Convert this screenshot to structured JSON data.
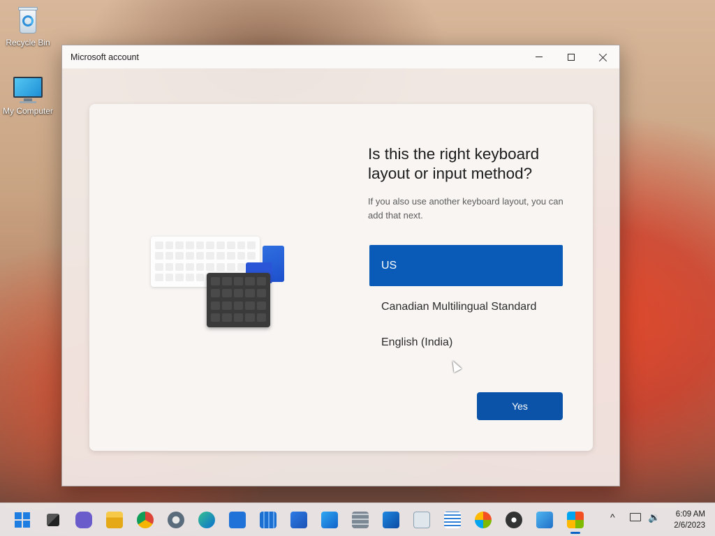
{
  "desktop": {
    "icons": [
      {
        "label": "Recycle Bin",
        "icon": "recycle-bin-icon"
      },
      {
        "label": "My Computer",
        "icon": "monitor-icon"
      }
    ]
  },
  "window": {
    "title": "Microsoft account",
    "controls": [
      "minimize",
      "maximize",
      "close"
    ]
  },
  "oobe": {
    "heading": "Is this the right keyboard layout or input method?",
    "description": "If you also use another keyboard layout, you can add that next.",
    "options": [
      {
        "label": "US",
        "selected": true
      },
      {
        "label": "Canadian Multilingual Standard",
        "selected": false
      },
      {
        "label": "English (India)",
        "selected": false
      }
    ],
    "primary_button": "Yes"
  },
  "taskbar": {
    "apps": [
      "start-icon",
      "task-view-icon",
      "chat-icon",
      "file-explorer-icon",
      "chrome-icon",
      "settings-icon",
      "edge-icon",
      "mail-icon",
      "calendar-icon",
      "store-icon",
      "photos-icon",
      "calculator-icon",
      "media-player-icon",
      "resource-monitor-icon",
      "notepad-icon",
      "paint-icon",
      "obs-icon",
      "remote-desktop-icon",
      "microsoft-account-icon"
    ],
    "active_app": "microsoft-account-icon",
    "clock": {
      "time": "6:09 AM",
      "date": "2/6/2023"
    }
  },
  "colors": {
    "accent": "#0a5bb8",
    "button": "#0b53a8",
    "taskbar": "#ece8e8"
  }
}
